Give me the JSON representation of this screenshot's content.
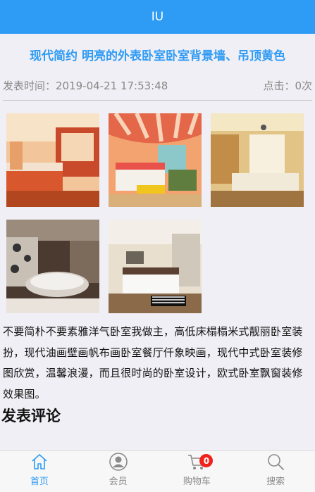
{
  "header": {
    "title": "IU"
  },
  "article": {
    "title": "现代简约 明亮的外表卧室卧室背景墙、吊顶黄色",
    "publish_time": "发表时间：2019-04-21 17:53:48",
    "clicks": "点击：0次",
    "body": "不要简朴不要素雅洋气卧室我做主，高低床榻榻米式靓丽卧室装扮，现代油画壁画帆布画卧室餐厅仟象映画，现代中式卧室装修图欣赏，温馨浪漫，而且很时尚的卧室设计，欧式卧室飘窗装修效果图。"
  },
  "comments": {
    "heading": "发表评论"
  },
  "tabbar": {
    "items": [
      {
        "label": "首页",
        "icon": "home-icon",
        "active": true
      },
      {
        "label": "会员",
        "icon": "user-icon",
        "active": false
      },
      {
        "label": "购物车",
        "icon": "cart-icon",
        "active": false,
        "badge": "0"
      },
      {
        "label": "搜索",
        "icon": "search-icon",
        "active": false
      }
    ]
  },
  "colors": {
    "accent": "#2e9bf5",
    "badge": "#f0221b"
  }
}
